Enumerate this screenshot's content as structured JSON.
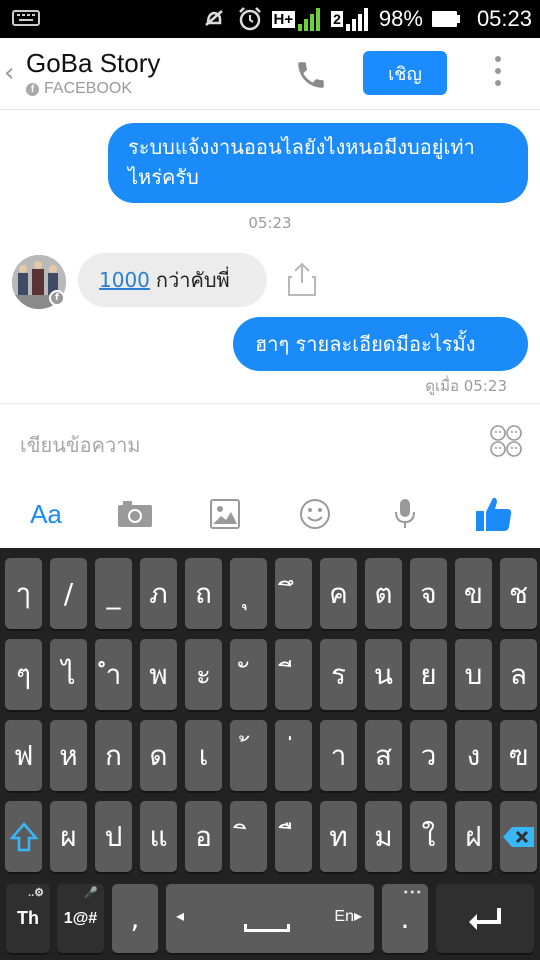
{
  "status": {
    "battery_pct": "98%",
    "time": "05:23",
    "network": "H+",
    "sim2": "2"
  },
  "header": {
    "title": "GoBa Story",
    "subtitle": "FACEBOOK",
    "invite_label": "เชิญ"
  },
  "messages": {
    "out1": "ระบบแจ้งงานออนไลยังไงหนอมีงบอยู่เท่าไหร่ครับ",
    "timestamp": "05:23",
    "in1_number": "1000",
    "in1_text": "กว่าคับพี่",
    "out2": "ฮาๆ รายละเอียดมีอะไรมั้ง",
    "seen": "ดูเมื่อ 05:23"
  },
  "compose": {
    "placeholder": "เขียนข้อความ",
    "aa_label": "Aa"
  },
  "keyboard": {
    "row1": [
      "ๅ",
      "/",
      "_",
      "ภ",
      "ถ",
      "ุ",
      "ึ",
      "ค",
      "ต",
      "จ",
      "ข",
      "ช"
    ],
    "row2": [
      "ๆ",
      "ไ",
      "ำ",
      "พ",
      "ะ",
      "ั",
      "ี",
      "ร",
      "น",
      "ย",
      "บ",
      "ล"
    ],
    "row3": [
      "ฟ",
      "ห",
      "ก",
      "ด",
      "เ",
      "้",
      "่",
      "า",
      "ส",
      "ว",
      "ง",
      "ฃ"
    ],
    "row4": [
      "ผ",
      "ป",
      "แ",
      "อ",
      "ิ",
      "ื",
      "ท",
      "ม",
      "ใ",
      "ฝ"
    ],
    "th_label": "Th",
    "sym_label": "1@#",
    "comma": ",",
    "lang_label": "En",
    "period": "."
  },
  "colors": {
    "accent": "#1b8bf9",
    "key": "#5c5c5c",
    "keyboard_bg": "#222222"
  }
}
